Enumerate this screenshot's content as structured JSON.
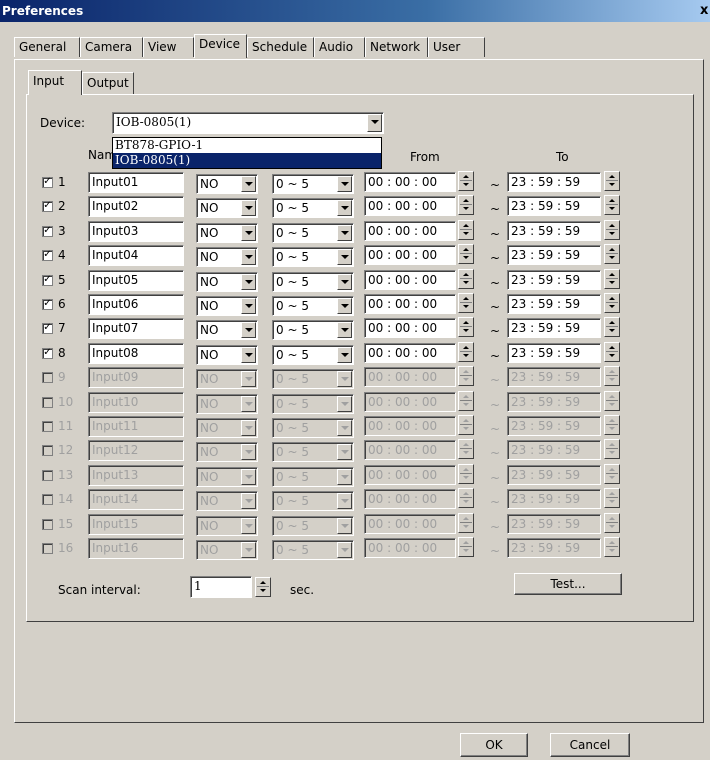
{
  "window": {
    "title": "Preferences",
    "close": "x"
  },
  "tabs": [
    "General",
    "Camera",
    "View",
    "Device",
    "Schedule",
    "Audio",
    "Network",
    "User"
  ],
  "active_tab": "Device",
  "subtabs": [
    "Input",
    "Output"
  ],
  "active_subtab": "Input",
  "device": {
    "label": "Device:",
    "selected": "IOB-0805(1)",
    "options": [
      "BT878-GPIO-1",
      "IOB-0805(1)"
    ],
    "highlighted": "IOB-0805(1)"
  },
  "columns": {
    "name": "Nam",
    "from": "From",
    "to": "To"
  },
  "rows": [
    {
      "enabled": true,
      "checked": true,
      "num": "1",
      "name": "Input01",
      "type": "NO",
      "range": "0 ~ 5",
      "from": "00 : 00 : 00",
      "to": "23 : 59 : 59"
    },
    {
      "enabled": true,
      "checked": true,
      "num": "2",
      "name": "Input02",
      "type": "NO",
      "range": "0 ~ 5",
      "from": "00 : 00 : 00",
      "to": "23 : 59 : 59"
    },
    {
      "enabled": true,
      "checked": true,
      "num": "3",
      "name": "Input03",
      "type": "NO",
      "range": "0 ~ 5",
      "from": "00 : 00 : 00",
      "to": "23 : 59 : 59"
    },
    {
      "enabled": true,
      "checked": true,
      "num": "4",
      "name": "Input04",
      "type": "NO",
      "range": "0 ~ 5",
      "from": "00 : 00 : 00",
      "to": "23 : 59 : 59"
    },
    {
      "enabled": true,
      "checked": true,
      "num": "5",
      "name": "Input05",
      "type": "NO",
      "range": "0 ~ 5",
      "from": "00 : 00 : 00",
      "to": "23 : 59 : 59"
    },
    {
      "enabled": true,
      "checked": true,
      "num": "6",
      "name": "Input06",
      "type": "NO",
      "range": "0 ~ 5",
      "from": "00 : 00 : 00",
      "to": "23 : 59 : 59"
    },
    {
      "enabled": true,
      "checked": true,
      "num": "7",
      "name": "Input07",
      "type": "NO",
      "range": "0 ~ 5",
      "from": "00 : 00 : 00",
      "to": "23 : 59 : 59"
    },
    {
      "enabled": true,
      "checked": true,
      "num": "8",
      "name": "Input08",
      "type": "NO",
      "range": "0 ~ 5",
      "from": "00 : 00 : 00",
      "to": "23 : 59 : 59"
    },
    {
      "enabled": false,
      "checked": false,
      "num": "9",
      "name": "Input09",
      "type": "NO",
      "range": "0 ~ 5",
      "from": "00 : 00 : 00",
      "to": "23 : 59 : 59"
    },
    {
      "enabled": false,
      "checked": false,
      "num": "10",
      "name": "Input10",
      "type": "NO",
      "range": "0 ~ 5",
      "from": "00 : 00 : 00",
      "to": "23 : 59 : 59"
    },
    {
      "enabled": false,
      "checked": false,
      "num": "11",
      "name": "Input11",
      "type": "NO",
      "range": "0 ~ 5",
      "from": "00 : 00 : 00",
      "to": "23 : 59 : 59"
    },
    {
      "enabled": false,
      "checked": false,
      "num": "12",
      "name": "Input12",
      "type": "NO",
      "range": "0 ~ 5",
      "from": "00 : 00 : 00",
      "to": "23 : 59 : 59"
    },
    {
      "enabled": false,
      "checked": false,
      "num": "13",
      "name": "Input13",
      "type": "NO",
      "range": "0 ~ 5",
      "from": "00 : 00 : 00",
      "to": "23 : 59 : 59"
    },
    {
      "enabled": false,
      "checked": false,
      "num": "14",
      "name": "Input14",
      "type": "NO",
      "range": "0 ~ 5",
      "from": "00 : 00 : 00",
      "to": "23 : 59 : 59"
    },
    {
      "enabled": false,
      "checked": false,
      "num": "15",
      "name": "Input15",
      "type": "NO",
      "range": "0 ~ 5",
      "from": "00 : 00 : 00",
      "to": "23 : 59 : 59"
    },
    {
      "enabled": false,
      "checked": false,
      "num": "16",
      "name": "Input16",
      "type": "NO",
      "range": "0 ~ 5",
      "from": "00 : 00 : 00",
      "to": "23 : 59 : 59"
    }
  ],
  "range_separator": "~",
  "scan": {
    "label": "Scan interval:",
    "value": "1",
    "unit": "sec."
  },
  "buttons": {
    "test": "Test...",
    "ok": "OK",
    "cancel": "Cancel"
  }
}
